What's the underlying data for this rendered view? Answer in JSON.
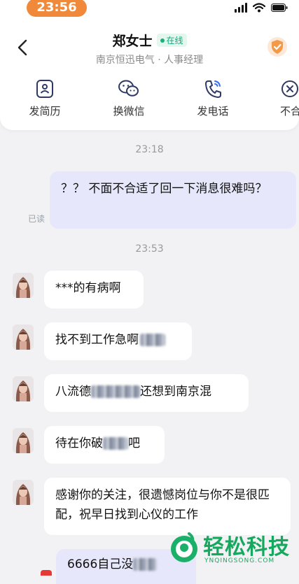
{
  "status_bar": {
    "time": "23:56"
  },
  "header": {
    "name": "郑女士",
    "online_label": "在线",
    "subtitle": "南京恒迅电气 · 人事经理"
  },
  "actions": [
    {
      "label": "发简历",
      "icon": "resume-icon"
    },
    {
      "label": "换微信",
      "icon": "wechat-icon"
    },
    {
      "label": "发电话",
      "icon": "phone-icon"
    },
    {
      "label": "不合",
      "icon": "reject-icon"
    }
  ],
  "chat": {
    "timestamp_1": "23:18",
    "outgoing_1": "？？ 不面不合适了回一下消息很难吗？",
    "read_label": "已读",
    "timestamp_2": "23:53",
    "msg_1": "***的有病啊",
    "msg_2_text": "找不到工作急啊",
    "msg_3_before": "八流德",
    "msg_3_after": "还想到南京混",
    "msg_4_before": "待在你破",
    "msg_4_after": "吧",
    "msg_5": "感谢你的关注，很遗憾岗位与你不是很匹配，祝早日找到心仪的工作",
    "outgoing_2_partial": "6666自己没"
  },
  "watermark": {
    "title": "轻松科技",
    "subtitle": "YNQINGSONG.COM"
  },
  "colors": {
    "accent_orange": "#f08a3a",
    "online_green": "#1bb07d",
    "outgoing_bubble": "#e6e7fb",
    "page_bg": "#f2f2f4"
  }
}
